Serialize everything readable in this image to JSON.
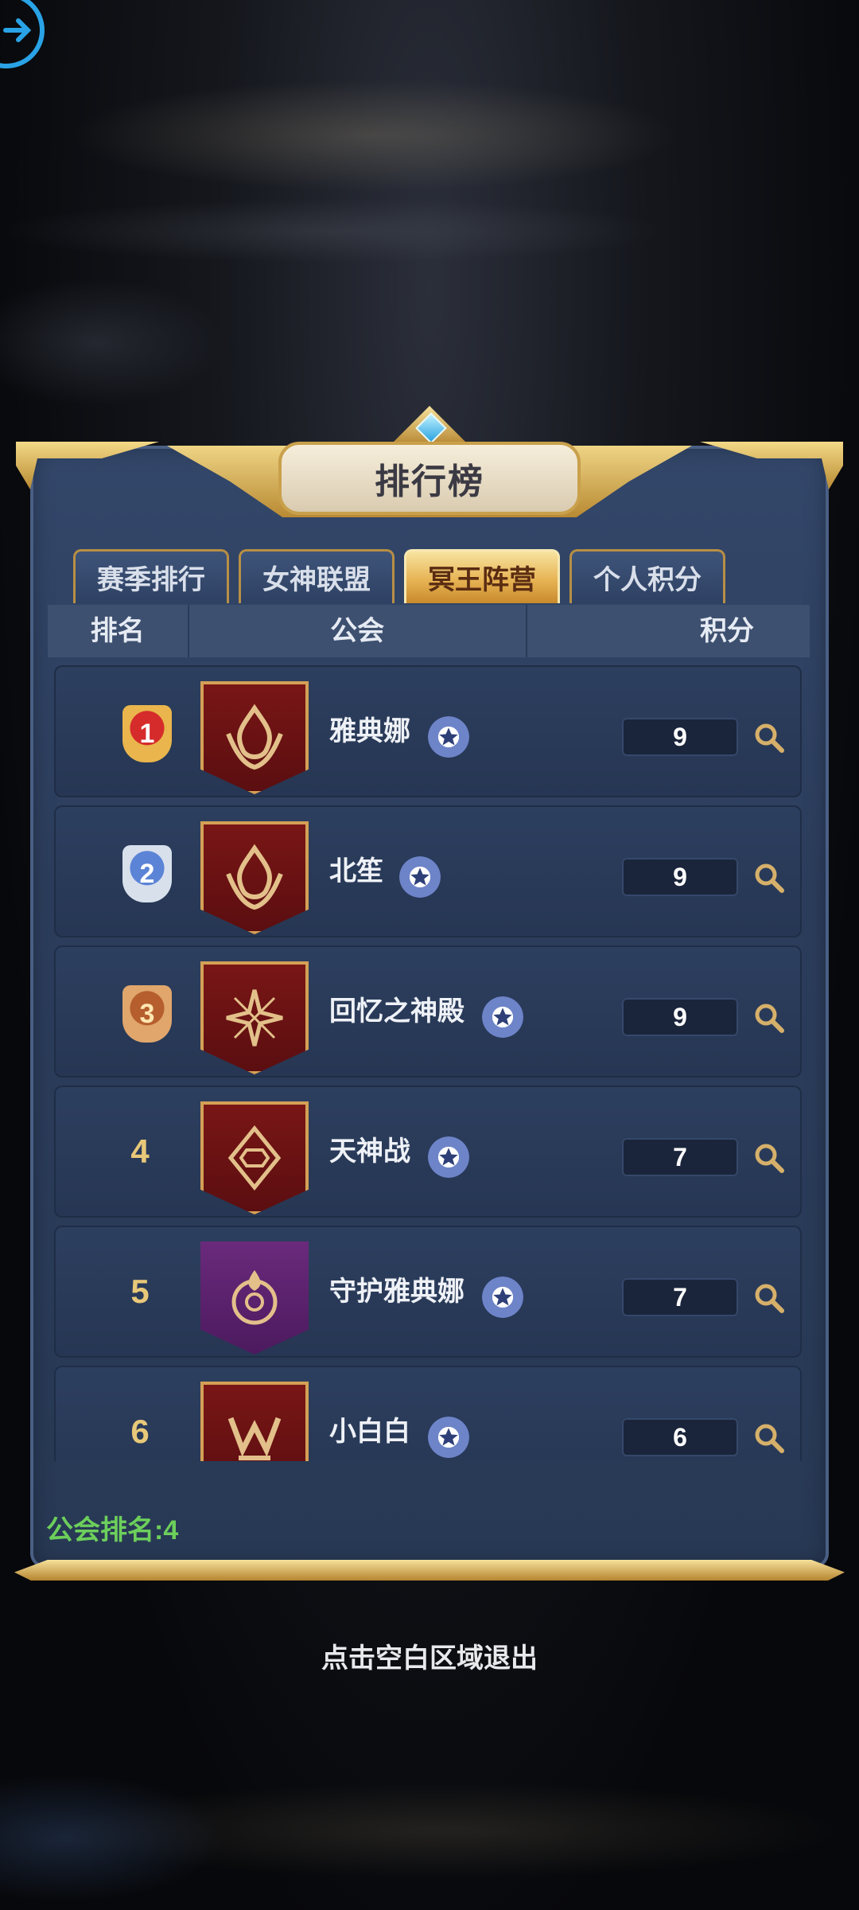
{
  "title": "排行榜",
  "tabs": [
    {
      "label": "赛季排行",
      "active": false
    },
    {
      "label": "女神联盟",
      "active": false
    },
    {
      "label": "冥王阵营",
      "active": true
    },
    {
      "label": "个人积分",
      "active": false
    }
  ],
  "headers": {
    "rank": "排名",
    "guild": "公会",
    "score": "积分"
  },
  "rows": [
    {
      "rank": "1",
      "guild": "雅典娜",
      "score": "9",
      "emblem": "flame-emblem-icon"
    },
    {
      "rank": "2",
      "guild": "北笙",
      "score": "9",
      "emblem": "flame-emblem-icon"
    },
    {
      "rank": "3",
      "guild": "回忆之神殿",
      "score": "9",
      "emblem": "star-burst-emblem-icon"
    },
    {
      "rank": "4",
      "guild": "天神战",
      "score": "7",
      "emblem": "hexagon-emblem-icon"
    },
    {
      "rank": "5",
      "guild": "守护雅典娜",
      "score": "7",
      "emblem": "lotus-emblem-icon"
    },
    {
      "rank": "6",
      "guild": "小白白",
      "score": "6",
      "emblem": "crown-emblem-icon"
    }
  ],
  "footer_rank": "公会排名:4",
  "exit_hint": "点击空白区域退出",
  "colors": {
    "accent_gold": "#e8c879",
    "active_tab": "#e7b454",
    "footer_green": "#6ccf5b",
    "exit_blue": "#29a3e6"
  }
}
